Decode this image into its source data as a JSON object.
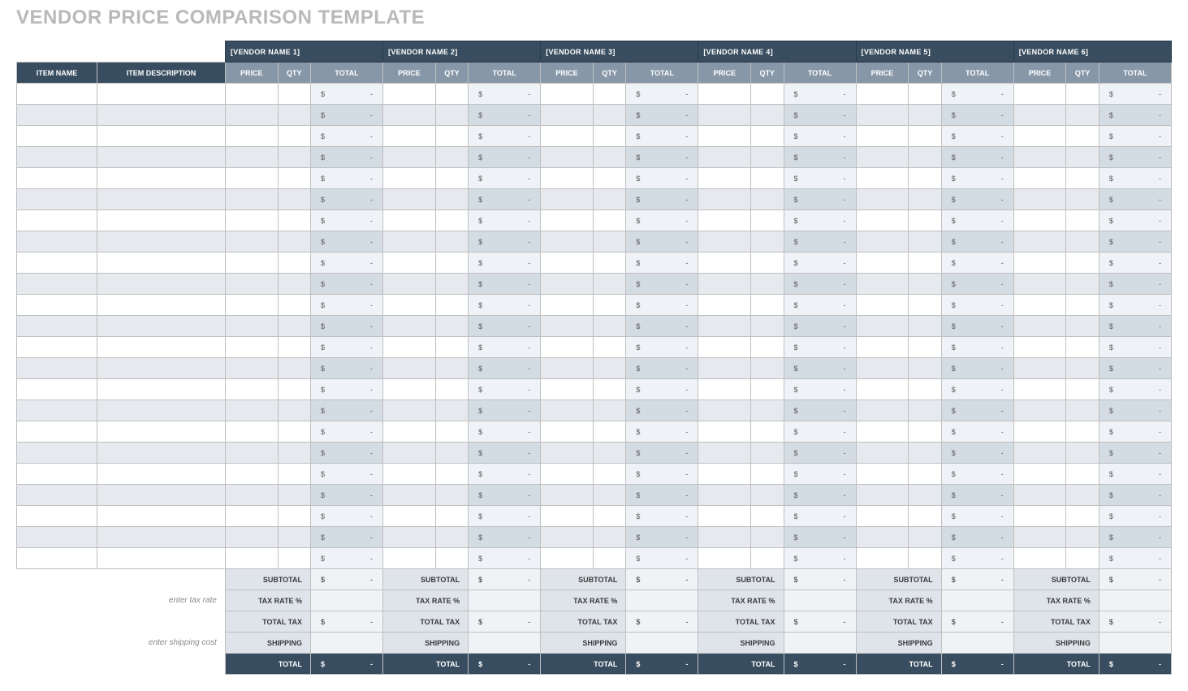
{
  "title": "VENDOR PRICE COMPARISON TEMPLATE",
  "item_headers": {
    "name": "ITEM NAME",
    "desc": "ITEM DESCRIPTION"
  },
  "col_labels": {
    "price": "PRICE",
    "qty": "QTY",
    "total": "TOTAL"
  },
  "vendors": [
    {
      "name": "[VENDOR NAME 1]"
    },
    {
      "name": "[VENDOR NAME 2]"
    },
    {
      "name": "[VENDOR NAME 3]"
    },
    {
      "name": "[VENDOR NAME 4]"
    },
    {
      "name": "[VENDOR NAME 5]"
    },
    {
      "name": "[VENDOR NAME 6]"
    }
  ],
  "rows": 23,
  "currency_symbol": "$",
  "empty_mark": "-",
  "summary": {
    "subtotal": "SUBTOTAL",
    "tax_rate": "TAX RATE %",
    "total_tax": "TOTAL TAX",
    "shipping": "SHIPPING",
    "total": "TOTAL",
    "hint_tax": "enter tax rate",
    "hint_ship": "enter shipping cost"
  }
}
